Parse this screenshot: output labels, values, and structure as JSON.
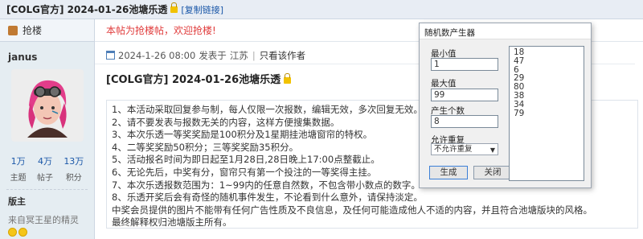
{
  "topbar": {
    "title": "[COLG官方] 2024-01-26池塘乐透",
    "copy_link": "[复制链接]"
  },
  "sidebar": {
    "grab_label": "抢楼",
    "username": "janus",
    "stats": [
      {
        "value": "1万",
        "label": "主题"
      },
      {
        "value": "4万",
        "label": "帖子"
      },
      {
        "value": "13万",
        "label": "积分"
      }
    ],
    "role": "版主",
    "signature": "来自冥王星的精灵"
  },
  "main": {
    "notice": "本帖为抢楼帖，欢迎抢楼!",
    "post_meta": {
      "datetime": "2024-1-26 08:00",
      "posted_from": "发表于",
      "location": "江苏",
      "only_author": "只看该作者"
    },
    "post_title": "[COLG官方] 2024-01-26池塘乐透",
    "content_lines": [
      "1、本活动采取回复参与制，每人仅限一次报数，编辑无效，多次回复无效。",
      "2、请不要发表与报数无关的内容，这样方便搜集数据。",
      "3、本次乐透一等奖奖励是100积分及1星期挂池塘窗帘的特权。",
      "4、二等奖奖励50积分；三等奖奖励35积分。",
      "5、活动报名时间为即日起至1月28日,28日晚上17:00点整截止。",
      "6、无论先后，中奖有分，窗帘只有第一个投注的一等奖得主挂。",
      "7、本次乐透报数范围为：1~99内的任意自然数，不包含带小数点的数字。",
      "8、乐透开奖后会有奇怪的随机事件发生，不论看到什么意外，请保持淡定。",
      "中奖会员提供的图片不能带有任何广告性质及不良信息，及任何可能造成他人不适的内容，并且符合池塘版块的风格。",
      "最终解释权归池塘版主所有。"
    ]
  },
  "dialog": {
    "title": "随机数产生器",
    "min_label": "最小值",
    "min_value": "1",
    "max_label": "最大值",
    "max_value": "99",
    "count_label": "产生个数",
    "count_value": "8",
    "repeat_label": "允许重复",
    "repeat_value": "不允许重复",
    "generate_label": "生成",
    "close_label": "关闭",
    "results": [
      "18",
      "47",
      "6",
      "29",
      "80",
      "38",
      "34",
      "79"
    ]
  }
}
